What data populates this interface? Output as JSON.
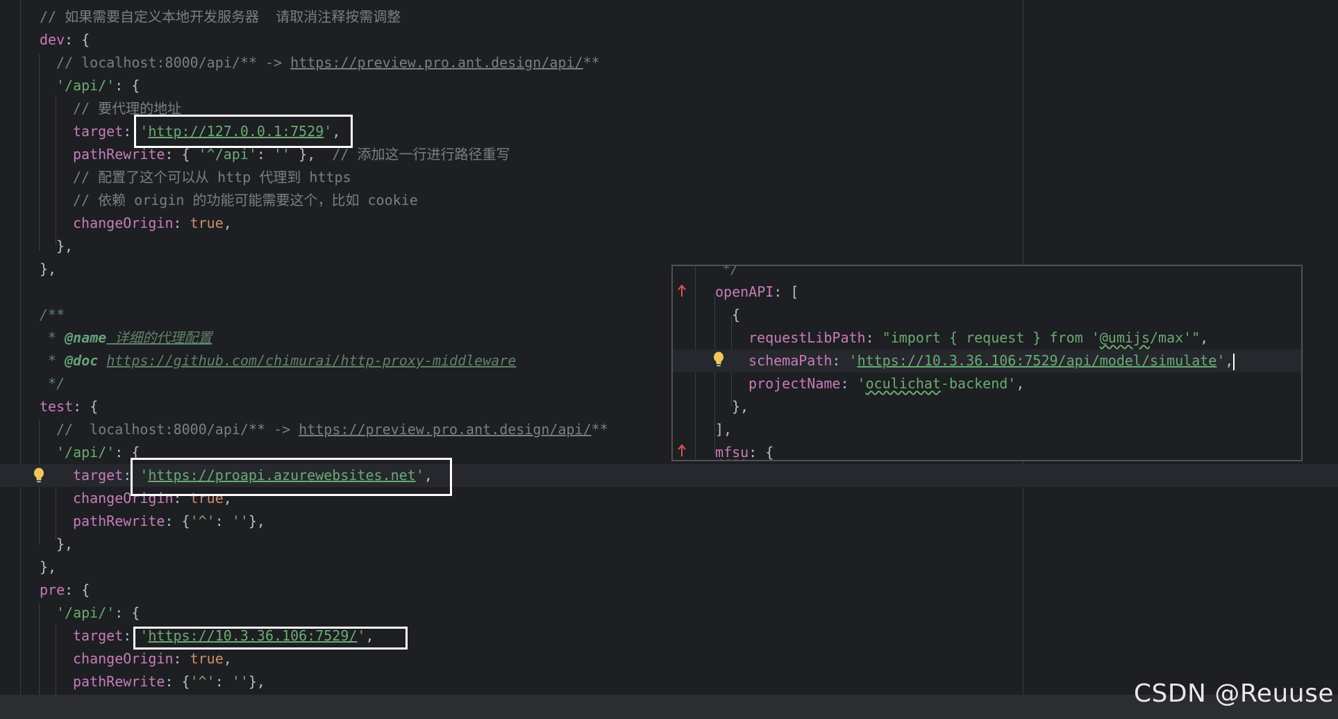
{
  "editor": {
    "lines": {
      "l0_com": "// 如果需要自定义本地开发服务器  请取消注释按需调整",
      "l1_key": "dev",
      "l1_rest": ": {",
      "l2_com": "// localhost:8000/api/** -> ",
      "l2_link": "https://preview.pro.ant.design/api/",
      "l2_tail": "**",
      "l3_key": "'/api/'",
      "l3_rest": ": {",
      "l4_com": "// 要代理的地址",
      "l5_key": "target",
      "l5_colon": ": ",
      "l5_str_q1": "'",
      "l5_str": "http://127.0.0.1:7529",
      "l5_str_q2": "'",
      "l5_tail": ",",
      "l6_key": "pathRewrite",
      "l6_mid": ": { ",
      "l6_str1": "'^/api'",
      "l6_colon": ": ",
      "l6_str2": "''",
      "l6_close": " },  ",
      "l6_com": "// 添加这一行进行路径重写",
      "l7_com": "// 配置了这个可以从 http 代理到 https",
      "l8_com": "// 依赖 origin 的功能可能需要这个，比如 cookie",
      "l9_key": "changeOrigin",
      "l9_colon": ": ",
      "l9_kw": "true",
      "l9_tail": ",",
      "l10": "},",
      "l11": "},",
      "l13_doc": "/**",
      "l14_star": " * ",
      "l14_tag": "@name",
      "l14_text": " 详细的代理配置",
      "l15_star": " * ",
      "l15_tag": "@doc",
      "l15_space": " ",
      "l15_link": "https://github.com/chimurai/http-proxy-middleware",
      "l16_doc": " */",
      "l17_key": "test",
      "l17_rest": ": {",
      "l18_com": "//  localhost:8000/api/** -> ",
      "l18_link": "https://preview.pro.ant.design/api/",
      "l18_tail": "**",
      "l19_key": "'/api/'",
      "l19_rest": ": {",
      "l20_key": "target",
      "l20_colon": ": ",
      "l20_q1": "'",
      "l20_str": "https://proapi.azurewebsites.net",
      "l20_q2": "'",
      "l20_tail": ",",
      "l21_key": "changeOrigin",
      "l21_colon": ": ",
      "l21_kw": "true",
      "l21_tail": ",",
      "l22_key": "pathRewrite",
      "l22_mid": ": {",
      "l22_s1": "'^'",
      "l22_colon": ": ",
      "l22_s2": "''",
      "l22_tail": "},",
      "l23": "},",
      "l24": "},",
      "l25_key": "pre",
      "l25_rest": ": {",
      "l26_key": "'/api/'",
      "l26_rest": ": {",
      "l27_key": "target",
      "l27_colon": ": ",
      "l27_q1": "'",
      "l27_str": "https://10.3.36.106:7529/",
      "l27_q2": "'",
      "l27_tail": ",",
      "l28_key": "changeOrigin",
      "l28_colon": ": ",
      "l28_kw": "true",
      "l28_tail": ",",
      "l29_key": "pathRewrite",
      "l29_mid": ": {",
      "l29_s1": "'^'",
      "l29_colon": ": ",
      "l29_s2": "''",
      "l29_tail": "},"
    }
  },
  "popup": {
    "p0_doc": "*/",
    "p1_key": "openAPI",
    "p1_rest": ": [",
    "p2": "{",
    "p3_key": "requestLibPath",
    "p3_colon": ": ",
    "p3_s1": "\"import { request } from '",
    "p3_umi": "@umijs",
    "p3_s2": "/max'\"",
    "p3_tail": ",",
    "p4_key": "schemaPath",
    "p4_colon": ": ",
    "p4_q1": "'",
    "p4_link": "https://10.3.36.106:7529/api/model/simulate",
    "p4_q2": "'",
    "p4_tail": ",",
    "p5_key": "projectName",
    "p5_colon": ": ",
    "p5_q1": "'",
    "p5_name": "oculichat",
    "p5_s2": "-backend'",
    "p5_tail": ",",
    "p6": "},",
    "p7": "],",
    "p8_key": "mfsu",
    "p8_rest": ": {"
  },
  "watermark": "CSDN @Reuuse",
  "icons": {
    "intention_bulb": "lightbulb-icon",
    "vcs_change_marker": "change-arrow-icon"
  },
  "colors": {
    "background": "#1e1f22",
    "keyword_property": "#c77dbb",
    "string": "#6aab73",
    "comment": "#7a7e85",
    "boolean": "#cf8e6d",
    "bulb": "#f2c55c",
    "highlight_box": "#ffffff"
  }
}
